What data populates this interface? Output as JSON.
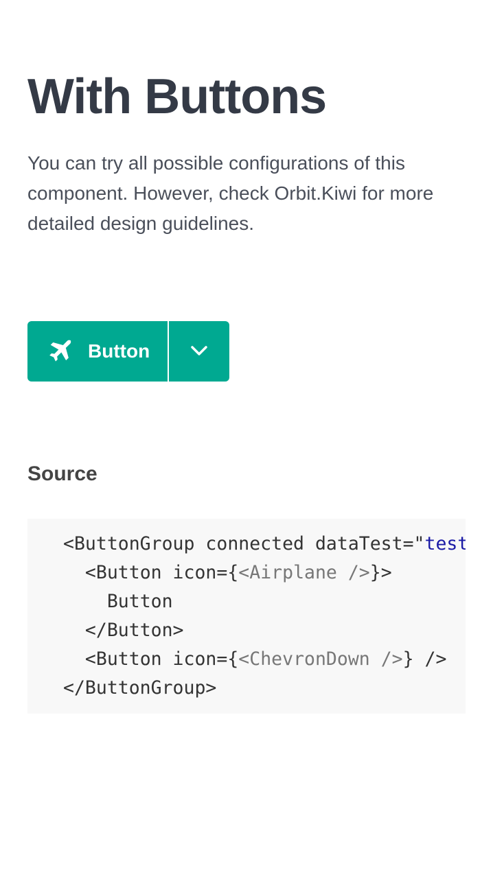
{
  "page": {
    "title": "With Buttons",
    "description": "You can try all possible configurations of this component. However, check Orbit.Kiwi for more detailed design guidelines."
  },
  "button_group": {
    "main_button_label": "Button",
    "main_button_icon": "airplane-icon",
    "secondary_button_icon": "chevron-down-icon",
    "accent_color": "#00a991"
  },
  "source": {
    "heading": "Source",
    "lines": [
      {
        "indent": "",
        "parts": [
          {
            "t": "<ButtonGroup connected dataTest=\"",
            "c": ""
          },
          {
            "t": "test\"",
            "c": "str"
          },
          {
            "t": ">",
            "c": ""
          }
        ]
      },
      {
        "indent": "  ",
        "parts": [
          {
            "t": "<Button icon={",
            "c": ""
          },
          {
            "t": "<Airplane />",
            "c": "jsx"
          },
          {
            "t": "}>",
            "c": ""
          }
        ]
      },
      {
        "indent": "    ",
        "parts": [
          {
            "t": "Button",
            "c": ""
          }
        ]
      },
      {
        "indent": "  ",
        "parts": [
          {
            "t": "</Button>",
            "c": ""
          }
        ]
      },
      {
        "indent": "  ",
        "parts": [
          {
            "t": "<Button icon={",
            "c": ""
          },
          {
            "t": "<ChevronDown />",
            "c": "jsx"
          },
          {
            "t": "} />",
            "c": ""
          }
        ]
      },
      {
        "indent": "",
        "parts": [
          {
            "t": "</ButtonGroup>",
            "c": ""
          }
        ]
      }
    ]
  }
}
